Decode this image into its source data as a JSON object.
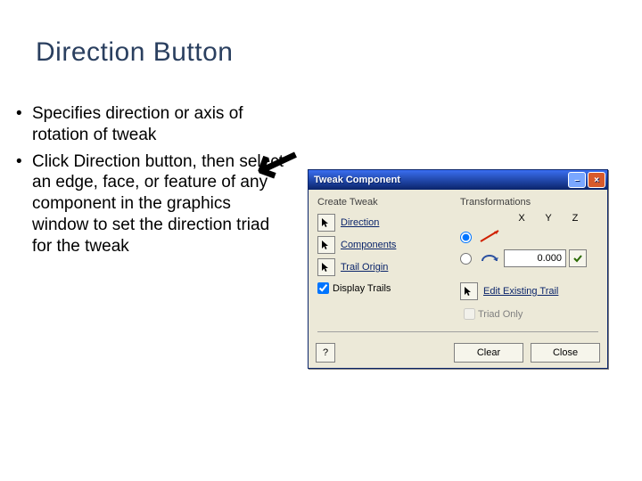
{
  "slide": {
    "title": "Direction Button",
    "bullets": [
      "Specifies direction or axis of rotation of tweak",
      "Click Direction button, then select an edge, face, or feature of any component in the graphics window to set the direction triad for the tweak"
    ]
  },
  "dialog": {
    "title": "Tweak Component",
    "group_create": "Create Tweak",
    "group_trans": "Transformations",
    "btn_direction": "Direction",
    "btn_components": "Components",
    "btn_trail": "Trail Origin",
    "chk_display_trails": "Display Trails",
    "display_trails_checked": true,
    "axis_x": "X",
    "axis_y": "Y",
    "axis_z": "Z",
    "value": "0.000",
    "edit_trail": "Edit Existing Trail",
    "triad_only": "Triad Only",
    "triad_only_enabled": false,
    "btn_clear": "Clear",
    "btn_close": "Close",
    "help": "?"
  }
}
